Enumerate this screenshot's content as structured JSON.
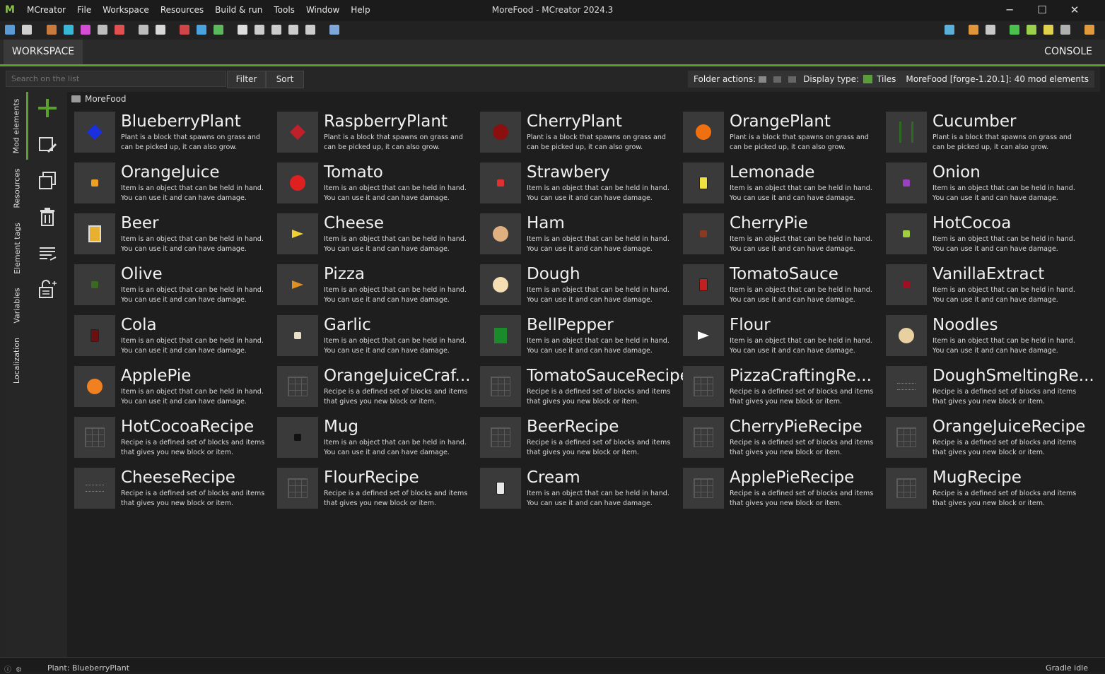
{
  "titlebar": {
    "app_name": "MCreator",
    "menus": [
      "File",
      "Workspace",
      "Resources",
      "Build & run",
      "Tools",
      "Window",
      "Help"
    ],
    "window_title": "MoreFood - MCreator 2024.3",
    "minimize": "─",
    "maximize": "☐",
    "close": "✕"
  },
  "toolbar": {
    "colors": [
      "#5b9bd5",
      "#cfcfcf",
      "#c97b3d",
      "#39b7d6",
      "#d54dd5",
      "#bdbdbd",
      "#e05050",
      "#bdbdbd",
      "#d8d8d8",
      "#d04545",
      "#4aa3df",
      "#5cb85c",
      "#dddddd",
      "#cccccc",
      "#cccccc",
      "#cccccc",
      "#cccccc",
      "#7fa6d9"
    ],
    "right_colors": [
      "#5ab0d8",
      "#e0953b",
      "#c8c8c8",
      "#4cc04c",
      "#9ad04a",
      "#e0d04a",
      "#b0b0b0",
      "#e09a3b"
    ]
  },
  "tabs": {
    "workspace": "WORKSPACE",
    "console": "CONSOLE"
  },
  "filterbar": {
    "search_placeholder": "Search on the list",
    "filter": "Filter",
    "sort": "Sort",
    "folder_actions": "Folder actions:",
    "display_type": "Display type:",
    "tiles": "Tiles",
    "workspace_info": "MoreFood [forge-1.20.1]: 40 mod elements"
  },
  "vtabs": [
    "Mod elements",
    "Resources",
    "Element tags",
    "Variables",
    "Localization"
  ],
  "breadcrumb": "MoreFood",
  "descriptions": {
    "plant": "Plant is a block that spawns on grass and can be picked up, it can also grow.",
    "item": "Item is an object that can be held in hand. You can use it and can have damage.",
    "recipe": "Recipe is a defined set of blocks and items that gives you new block or item."
  },
  "elements": [
    {
      "name": "BlueberryPlant",
      "type": "plant",
      "icon_color": "#1a2fe0",
      "icon": "plant"
    },
    {
      "name": "RaspberryPlant",
      "type": "plant",
      "icon_color": "#c0202a",
      "icon": "plant"
    },
    {
      "name": "CherryPlant",
      "type": "plant",
      "icon_color": "#8a1010",
      "icon": "ball"
    },
    {
      "name": "OrangePlant",
      "type": "plant",
      "icon_color": "#f07010",
      "icon": "ball"
    },
    {
      "name": "Cucumber",
      "type": "plant",
      "icon_color": "#2f6a22",
      "icon": "stalk"
    },
    {
      "name": "OrangeJuice",
      "type": "item",
      "icon_color": "#f0a020",
      "icon": "small"
    },
    {
      "name": "Tomato",
      "type": "item",
      "icon_color": "#e02020",
      "icon": "ball"
    },
    {
      "name": "Strawbery",
      "type": "item",
      "icon_color": "#e03030",
      "icon": "small"
    },
    {
      "name": "Lemonade",
      "type": "item",
      "icon_color": "#f0e040",
      "icon": "bottle"
    },
    {
      "name": "Onion",
      "type": "item",
      "icon_color": "#9a40c0",
      "icon": "small"
    },
    {
      "name": "Beer",
      "type": "item",
      "icon_color": "#e8b030",
      "icon": "mug"
    },
    {
      "name": "Cheese",
      "type": "item",
      "icon_color": "#f0d030",
      "icon": "wedge"
    },
    {
      "name": "Ham",
      "type": "item",
      "icon_color": "#e0b080",
      "icon": "ball"
    },
    {
      "name": "CherryPie",
      "type": "item",
      "icon_color": "#8a3a20",
      "icon": "small"
    },
    {
      "name": "HotCocoa",
      "type": "item",
      "icon_color": "#a0d040",
      "icon": "small"
    },
    {
      "name": "Olive",
      "type": "item",
      "icon_color": "#3a6a20",
      "icon": "small"
    },
    {
      "name": "Pizza",
      "type": "item",
      "icon_color": "#e09020",
      "icon": "wedge"
    },
    {
      "name": "Dough",
      "type": "item",
      "icon_color": "#f5deb3",
      "icon": "ball"
    },
    {
      "name": "TomatoSauce",
      "type": "item",
      "icon_color": "#c02020",
      "icon": "bottle"
    },
    {
      "name": "VanillaExtract",
      "type": "item",
      "icon_color": "#a01020",
      "icon": "small"
    },
    {
      "name": "Cola",
      "type": "item",
      "icon_color": "#6a1010",
      "icon": "bottle"
    },
    {
      "name": "Garlic",
      "type": "item",
      "icon_color": "#e8e0c8",
      "icon": "small"
    },
    {
      "name": "BellPepper",
      "type": "item",
      "icon_color": "#1a8a2a",
      "icon": "block"
    },
    {
      "name": "Flour",
      "type": "item",
      "icon_color": "#ffffff",
      "icon": "wedge"
    },
    {
      "name": "Noodles",
      "type": "item",
      "icon_color": "#e8d0a0",
      "icon": "ball"
    },
    {
      "name": "ApplePie",
      "type": "item",
      "icon_color": "#f08020",
      "icon": "ball"
    },
    {
      "name": "OrangeJuiceCraf...",
      "type": "recipe",
      "icon_color": "#555555",
      "icon": "grid"
    },
    {
      "name": "TomatoSauceRecipe",
      "type": "recipe",
      "icon_color": "#555555",
      "icon": "grid"
    },
    {
      "name": "PizzaCraftingRe...",
      "type": "recipe",
      "icon_color": "#555555",
      "icon": "grid"
    },
    {
      "name": "DoughSmeltingRe...",
      "type": "recipe",
      "icon_color": "#555555",
      "icon": "smelt"
    },
    {
      "name": "HotCocoaRecipe",
      "type": "recipe",
      "icon_color": "#555555",
      "icon": "grid"
    },
    {
      "name": "Mug",
      "type": "item",
      "icon_color": "#111111",
      "icon": "small"
    },
    {
      "name": "BeerRecipe",
      "type": "recipe",
      "icon_color": "#555555",
      "icon": "grid"
    },
    {
      "name": "CherryPieRecipe",
      "type": "recipe",
      "icon_color": "#555555",
      "icon": "grid"
    },
    {
      "name": "OrangeJuiceRecipe",
      "type": "recipe",
      "icon_color": "#555555",
      "icon": "grid"
    },
    {
      "name": "CheeseRecipe",
      "type": "recipe",
      "icon_color": "#555555",
      "icon": "smelt"
    },
    {
      "name": "FlourRecipe",
      "type": "recipe",
      "icon_color": "#555555",
      "icon": "grid"
    },
    {
      "name": "Cream",
      "type": "item",
      "icon_color": "#e8e8e8",
      "icon": "bottle"
    },
    {
      "name": "ApplePieRecipe",
      "type": "recipe",
      "icon_color": "#555555",
      "icon": "grid"
    },
    {
      "name": "MugRecipe",
      "type": "recipe",
      "icon_color": "#555555",
      "icon": "grid"
    }
  ],
  "status": {
    "left": "Plant: BlueberryPlant",
    "right": "Gradle idle"
  },
  "colors": {
    "accent": "#5aa02c",
    "background": "#1e1e1e",
    "panel": "#262626",
    "tile": "#3a3a3a"
  }
}
